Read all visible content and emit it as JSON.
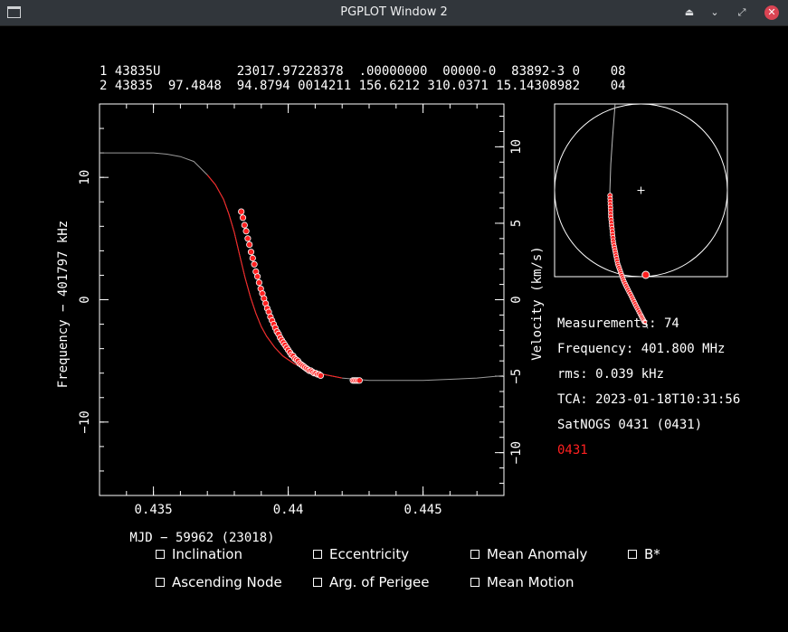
{
  "window": {
    "title": "PGPLOT Window 2",
    "buttons": [
      "keep-above",
      "minimize",
      "restore",
      "close"
    ]
  },
  "tle": {
    "line1": "1 43835U          23017.97228378  .00000000  00000-0  83892-3 0    08",
    "line2": "2 43835  97.4848  94.8794 0014211 156.6212 310.0371 15.14308982    04"
  },
  "info": {
    "measurements": "Measurements: 74",
    "frequency": "Frequency: 401.800 MHz",
    "rms": "rms: 0.039 kHz",
    "tca": "TCA: 2023-01-18T10:31:56",
    "station": "SatNOGS 0431 (0431)",
    "station_code": "0431",
    "station_code_color": "#ff2020"
  },
  "options": [
    {
      "label": "Inclination"
    },
    {
      "label": "Eccentricity"
    },
    {
      "label": "Mean Anomaly"
    },
    {
      "label": "B*"
    },
    {
      "label": "Ascending Node"
    },
    {
      "label": "Arg. of Perigee"
    },
    {
      "label": "Mean Motion"
    }
  ],
  "chart_data": {
    "type": "scatter",
    "xlabel": "MJD − 59962 (23018)",
    "ylabel": "Frequency − 401797 kHz",
    "y2label": "Velocity (km/s)",
    "xlim": [
      0.433,
      0.448
    ],
    "ylim": [
      -16,
      16
    ],
    "y2lim": [
      -12.8,
      12.8
    ],
    "xticks": [
      0.435,
      0.44,
      0.445
    ],
    "xtick_labels": [
      "0.435",
      "0.44",
      "0.445"
    ],
    "yticks": [
      -10,
      0,
      10
    ],
    "ytick_labels": [
      "−10",
      "0",
      "10"
    ],
    "y2ticks": [
      -10,
      -5,
      0,
      5,
      10
    ],
    "y2tick_labels": [
      "−10",
      "−5",
      "0",
      "5",
      "10"
    ],
    "model_curve": {
      "x": [
        0.433,
        0.434,
        0.435,
        0.4355,
        0.436,
        0.4365,
        0.437,
        0.4373,
        0.4376,
        0.4378,
        0.438,
        0.4382,
        0.4384,
        0.4386,
        0.4388,
        0.439,
        0.4392,
        0.4395,
        0.4398,
        0.4402,
        0.4407,
        0.4413,
        0.442,
        0.443,
        0.444,
        0.445,
        0.446,
        0.447,
        0.448
      ],
      "y": [
        12.0,
        12.0,
        12.0,
        11.9,
        11.7,
        11.3,
        10.2,
        9.4,
        8.2,
        7.0,
        5.5,
        3.6,
        1.8,
        0.2,
        -1.1,
        -2.2,
        -3.0,
        -3.9,
        -4.6,
        -5.2,
        -5.7,
        -6.1,
        -6.4,
        -6.6,
        -6.6,
        -6.6,
        -6.5,
        -6.4,
        -6.2
      ],
      "highlight_xrange": [
        0.4368,
        0.4427
      ],
      "colors": {
        "base": "#9a9a9a",
        "highlight": "#ff2020"
      }
    },
    "points": {
      "x": [
        0.43826,
        0.43832,
        0.43838,
        0.43844,
        0.4385,
        0.43856,
        0.43862,
        0.43868,
        0.43874,
        0.4388,
        0.43886,
        0.43892,
        0.43898,
        0.43904,
        0.4391,
        0.43916,
        0.43922,
        0.43928,
        0.43934,
        0.4394,
        0.43946,
        0.43952,
        0.43958,
        0.43964,
        0.4397,
        0.43976,
        0.43982,
        0.43988,
        0.43994,
        0.44,
        0.44006,
        0.44012,
        0.44018,
        0.44024,
        0.4403,
        0.44036,
        0.44042,
        0.44048,
        0.44054,
        0.4406,
        0.44066,
        0.44072,
        0.44078,
        0.44084,
        0.4409,
        0.44096,
        0.44102,
        0.44108,
        0.44114,
        0.4412,
        0.4424,
        0.44246,
        0.44252,
        0.44258,
        0.44264
      ],
      "y": [
        7.2,
        6.7,
        6.1,
        5.6,
        5.0,
        4.5,
        3.9,
        3.4,
        2.9,
        2.3,
        1.9,
        1.4,
        0.9,
        0.5,
        0.1,
        -0.3,
        -0.7,
        -1.0,
        -1.4,
        -1.7,
        -2.0,
        -2.3,
        -2.6,
        -2.8,
        -3.1,
        -3.3,
        -3.5,
        -3.7,
        -3.9,
        -4.1,
        -4.3,
        -4.5,
        -4.6,
        -4.8,
        -4.9,
        -5.0,
        -5.2,
        -5.3,
        -5.4,
        -5.5,
        -5.6,
        -5.7,
        -5.8,
        -5.8,
        -5.9,
        -6.0,
        -6.0,
        -6.1,
        -6.1,
        -6.2,
        -6.6,
        -6.6,
        -6.6,
        -6.6,
        -6.6
      ],
      "color": "#ff2020",
      "edge": "#ffffff"
    },
    "ground_track": {
      "station": [
        0,
        0
      ],
      "track_x": [
        -0.3,
        -0.33,
        -0.35,
        -0.36,
        -0.35,
        -0.32,
        -0.27,
        -0.2,
        -0.1,
        0.0,
        0.08
      ],
      "track_y": [
        1.0,
        0.6,
        0.3,
        0.0,
        -0.3,
        -0.6,
        -0.85,
        -1.05,
        -1.25,
        -1.45,
        -1.6
      ],
      "pass_t": [
        0.32,
        0.95
      ]
    }
  }
}
